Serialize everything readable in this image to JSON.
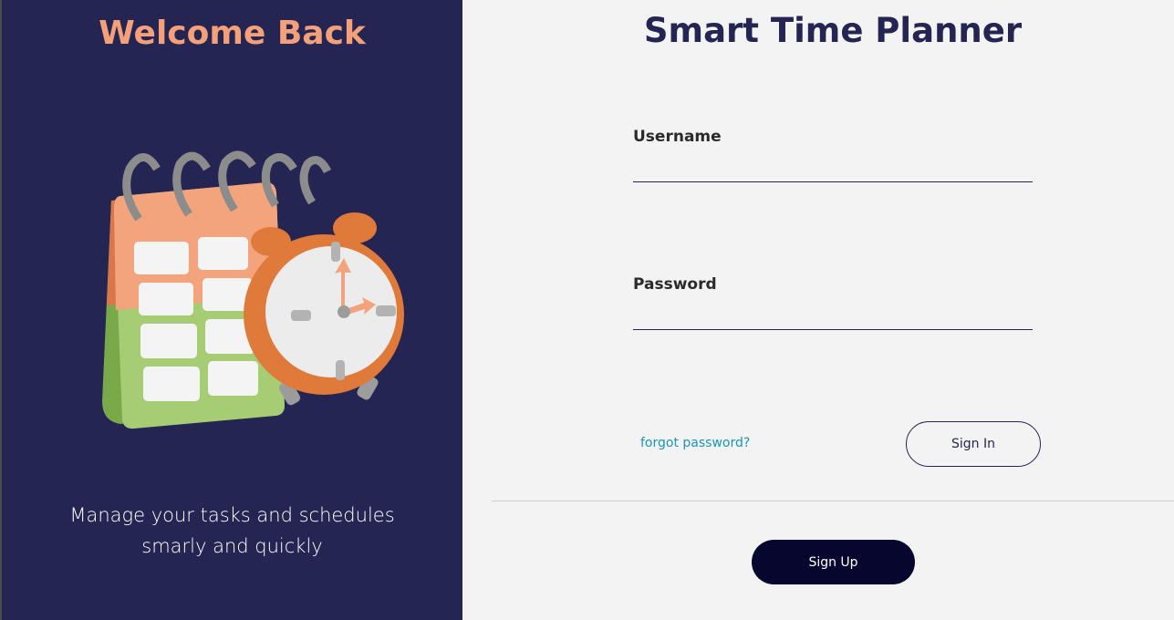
{
  "left_panel": {
    "title": "Welcome Back",
    "illustration_icon": "calendar-alarm-clock-icon",
    "tagline_line1": "Manage your tasks and schedules",
    "tagline_line2": "smarly and quickly"
  },
  "right_panel": {
    "title": "Smart Time Planner",
    "username": {
      "label": "Username",
      "value": "",
      "placeholder": ""
    },
    "password": {
      "label": "Password",
      "value": "",
      "placeholder": ""
    },
    "forgot_link": "forgot password?",
    "signin_label": "Sign In",
    "signup_label": "Sign Up"
  },
  "colors": {
    "panel_bg": "#252553",
    "title_accent": "#f4a079",
    "link": "#1c94b6",
    "signup_bg": "#06062e",
    "page_bg": "#f3f3f3"
  }
}
